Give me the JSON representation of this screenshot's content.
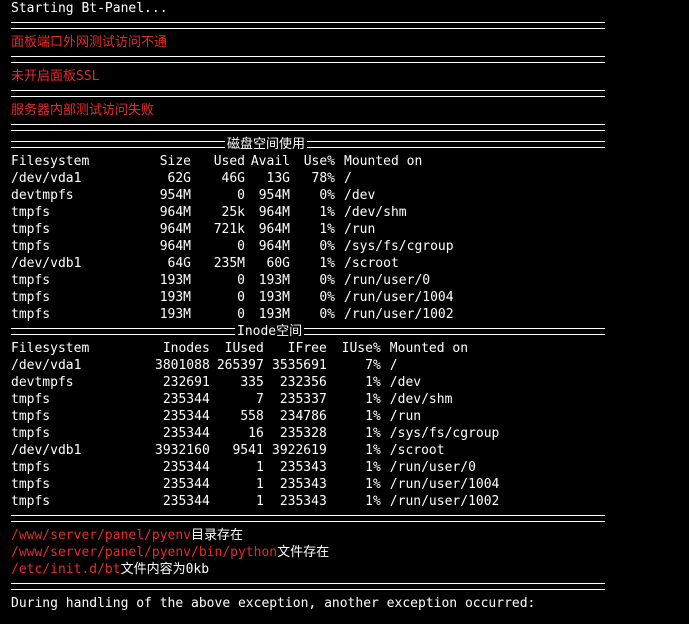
{
  "terminal": {
    "starting": "Starting Bt-Panel...",
    "msg_port_fail": "面板端口外网测试访问不通",
    "msg_ssl": "未开启面板SSL",
    "msg_internal_fail": "服务器内部测试访问失败",
    "disk_title": "磁盘空间使用",
    "inode_title": "Inode空间",
    "disk_headers": [
      "Filesystem",
      "Size",
      "Used",
      "Avail",
      "Use%",
      "Mounted on"
    ],
    "disk_rows": [
      [
        "/dev/vda1",
        "62G",
        "46G",
        "13G",
        "78%",
        "/"
      ],
      [
        "devtmpfs",
        "954M",
        "0",
        "954M",
        "0%",
        "/dev"
      ],
      [
        "tmpfs",
        "964M",
        "25k",
        "964M",
        "1%",
        "/dev/shm"
      ],
      [
        "tmpfs",
        "964M",
        "721k",
        "964M",
        "1%",
        "/run"
      ],
      [
        "tmpfs",
        "964M",
        "0",
        "964M",
        "0%",
        "/sys/fs/cgroup"
      ],
      [
        "/dev/vdb1",
        "64G",
        "235M",
        "60G",
        "1%",
        "/scroot"
      ],
      [
        "tmpfs",
        "193M",
        "0",
        "193M",
        "0%",
        "/run/user/0"
      ],
      [
        "tmpfs",
        "193M",
        "0",
        "193M",
        "0%",
        "/run/user/1004"
      ],
      [
        "tmpfs",
        "193M",
        "0",
        "193M",
        "0%",
        "/run/user/1002"
      ]
    ],
    "inode_headers": [
      "Filesystem",
      "Inodes",
      "IUsed",
      "IFree",
      "IUse%",
      "Mounted on"
    ],
    "inode_rows": [
      [
        "/dev/vda1",
        "3801088",
        "265397",
        "3535691",
        "7%",
        "/"
      ],
      [
        "devtmpfs",
        "232691",
        "335",
        "232356",
        "1%",
        "/dev"
      ],
      [
        "tmpfs",
        "235344",
        "7",
        "235337",
        "1%",
        "/dev/shm"
      ],
      [
        "tmpfs",
        "235344",
        "558",
        "234786",
        "1%",
        "/run"
      ],
      [
        "tmpfs",
        "235344",
        "16",
        "235328",
        "1%",
        "/sys/fs/cgroup"
      ],
      [
        "/dev/vdb1",
        "3932160",
        "9541",
        "3922619",
        "1%",
        "/scroot"
      ],
      [
        "tmpfs",
        "235344",
        "1",
        "235343",
        "1%",
        "/run/user/0"
      ],
      [
        "tmpfs",
        "235344",
        "1",
        "235343",
        "1%",
        "/run/user/1004"
      ],
      [
        "tmpfs",
        "235344",
        "1",
        "235343",
        "1%",
        "/run/user/1002"
      ]
    ],
    "pyenv_path": "/www/server/panel/pyenv",
    "pyenv_suffix": "目录存在",
    "python_path": "/www/server/panel/pyenv/bin/python",
    "python_suffix": "文件存在",
    "initd_path": "/etc/init.d/bt",
    "initd_suffix": "文件内容为0kb",
    "exception": "During handling of the above exception, another exception occurred:"
  },
  "colors": {
    "background": "#000000",
    "text": "#ffffff",
    "error": "#e8292a"
  }
}
